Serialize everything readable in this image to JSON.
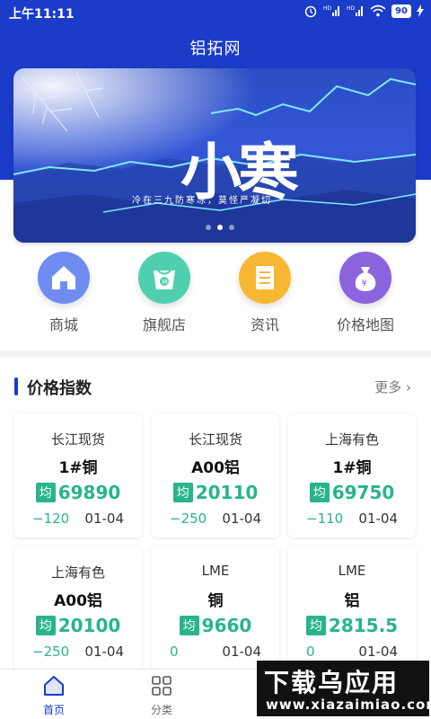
{
  "status_bar": {
    "time": "上午11:11",
    "battery": "90",
    "icons": [
      "alarm-icon",
      "signal-hd-icon",
      "signal-hd-icon",
      "wifi-icon",
      "battery-icon",
      "charging-icon"
    ]
  },
  "header": {
    "title": "铝拓网"
  },
  "banner": {
    "headline": "小寒",
    "subline": "冷在三九防寒冻，莫怪严凝切",
    "active_slide": 2,
    "slide_count": 3
  },
  "nav": [
    {
      "label": "商城",
      "icon": "house-icon",
      "color": "#6f8df0"
    },
    {
      "label": "旗舰店",
      "icon": "shopping-bag-icon",
      "color": "#4fcfb0"
    },
    {
      "label": "资讯",
      "icon": "document-icon",
      "color": "#f8b733"
    },
    {
      "label": "价格地图",
      "icon": "money-bag-icon",
      "color": "#8c63df"
    }
  ],
  "price_index": {
    "title": "价格指数",
    "more": "更多",
    "avg_label": "均",
    "cards": [
      {
        "source": "长江现货",
        "product": "1#铜",
        "price": "69890",
        "change": "−120",
        "date": "01-04"
      },
      {
        "source": "长江现货",
        "product": "A00铝",
        "price": "20110",
        "change": "−250",
        "date": "01-04"
      },
      {
        "source": "上海有色",
        "product": "1#铜",
        "price": "69750",
        "change": "−110",
        "date": "01-04"
      },
      {
        "source": "上海有色",
        "product": "A00铝",
        "price": "20100",
        "change": "−250",
        "date": "01-04"
      },
      {
        "source": "LME",
        "product": "铜",
        "price": "9660",
        "change": "0",
        "date": "01-04"
      },
      {
        "source": "LME",
        "product": "铝",
        "price": "2815.5",
        "change": "0",
        "date": "01-04"
      }
    ]
  },
  "tabbar": [
    {
      "label": "首页",
      "icon": "home-icon",
      "active": true
    },
    {
      "label": "分类",
      "icon": "grid-icon",
      "active": false
    }
  ],
  "watermark": {
    "big": "下载乌应用",
    "small": "www.xiazaimiao.com"
  },
  "colors": {
    "brand": "#1a3cc8",
    "up_down_green": "#28b48c"
  }
}
